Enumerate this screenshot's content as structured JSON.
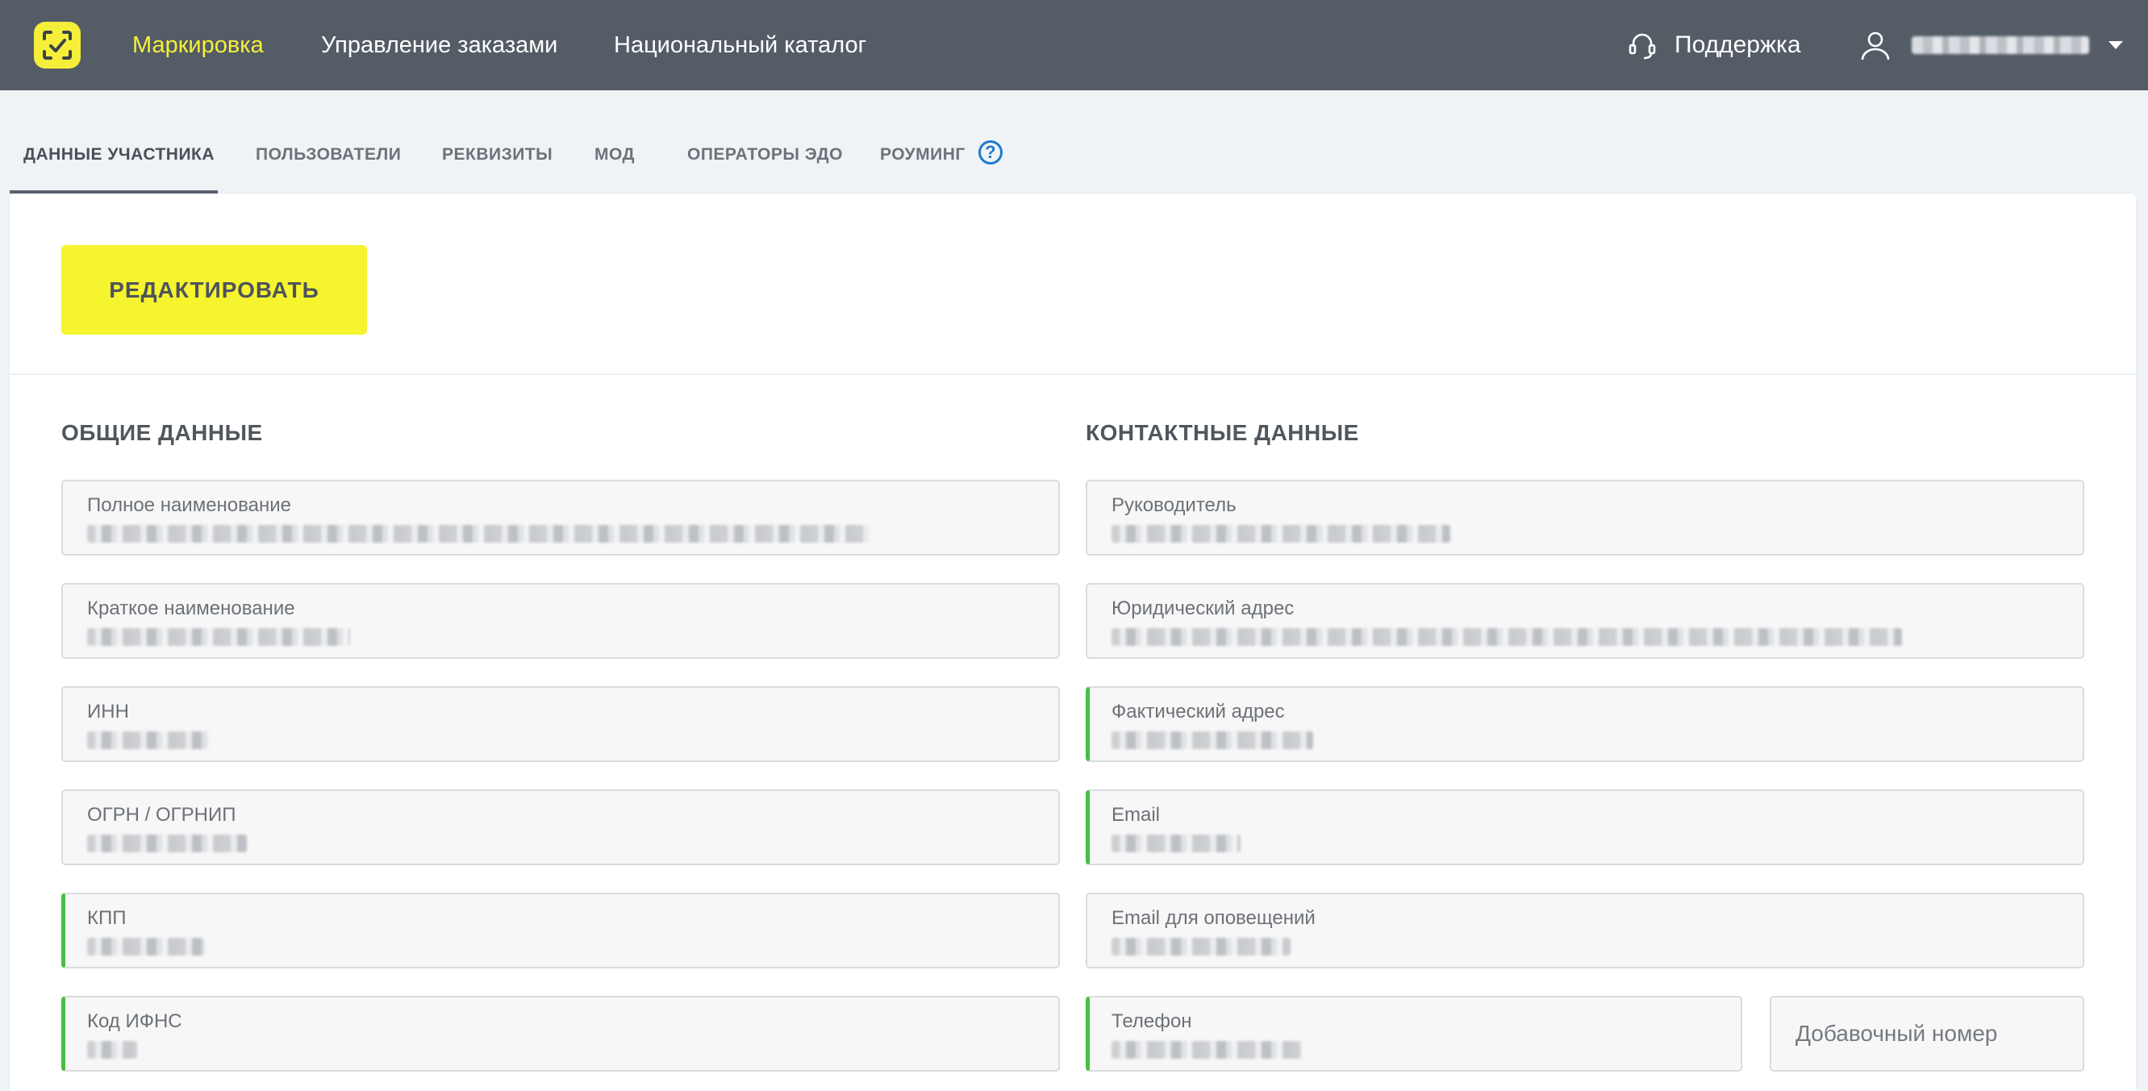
{
  "nav": {
    "items": [
      "Маркировка",
      "Управление заказами",
      "Национальный каталог"
    ],
    "active_index": 0,
    "support_label": "Поддержка",
    "accent_color": "#f6ef3a",
    "bar_color": "#545c66"
  },
  "tabs": {
    "items": [
      "ДАННЫЕ УЧАСТНИКА",
      "ПОЛЬЗОВАТЕЛИ",
      "РЕКВИЗИТЫ",
      "МОД",
      "ОПЕРАТОРЫ ЭДО",
      "РОУМИНГ"
    ],
    "active_index": 0
  },
  "actions": {
    "edit_label": "РЕДАКТИРОВАТЬ",
    "edit_color": "#f6f42e"
  },
  "general": {
    "title": "ОБЩИЕ ДАННЫЕ",
    "fields": [
      {
        "label": "Полное наименование"
      },
      {
        "label": "Краткое наименование"
      },
      {
        "label": "ИНН"
      },
      {
        "label": "ОГРН / ОГРНИП"
      },
      {
        "label": "КПП"
      },
      {
        "label": "Код ИФНС"
      }
    ]
  },
  "contacts": {
    "title": "КОНТАКТНЫЕ ДАННЫЕ",
    "fields": [
      {
        "label": "Руководитель"
      },
      {
        "label": "Юридический адрес"
      },
      {
        "label": "Фактический адрес"
      },
      {
        "label": "Email"
      },
      {
        "label": "Email для оповещений"
      },
      {
        "label": "Телефон"
      }
    ],
    "extension_placeholder": "Добавочный номер"
  },
  "colors": {
    "field_highlight": "#46bf3f",
    "help_icon": "#1f7ad1"
  }
}
